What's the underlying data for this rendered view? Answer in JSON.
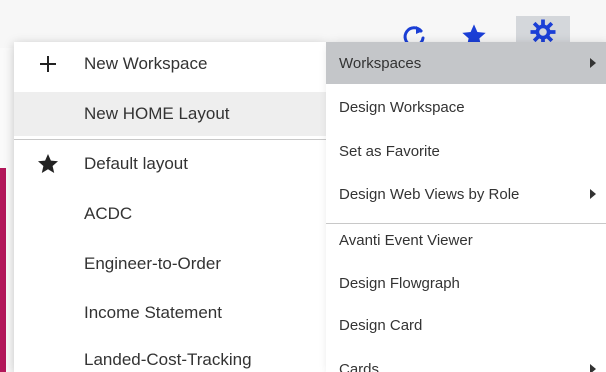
{
  "toolbar": {
    "icons": [
      "refresh-icon",
      "star-icon",
      "gear-icon"
    ],
    "accent_color": "#1b3fd6"
  },
  "workspace_menu": {
    "items": [
      {
        "icon": "plus-icon",
        "label": "New Workspace"
      },
      {
        "icon": "",
        "label": "New HOME Layout"
      },
      {
        "icon": "star-icon",
        "label": "Default layout"
      },
      {
        "icon": "",
        "label": "ACDC"
      },
      {
        "icon": "",
        "label": "Engineer-to-Order"
      },
      {
        "icon": "",
        "label": "Income Statement"
      },
      {
        "icon": "",
        "label": "Landed-Cost-Tracking"
      }
    ],
    "highlighted": "New HOME Layout"
  },
  "settings_menu": {
    "items": [
      {
        "label": "Workspaces",
        "submenu": true
      },
      {
        "label": "Design Workspace",
        "submenu": false
      },
      {
        "label": "Set as Favorite",
        "submenu": false
      },
      {
        "label": "Design Web Views by Role",
        "submenu": true
      },
      {
        "label": "Avanti Event Viewer",
        "submenu": false
      },
      {
        "label": "Design Flowgraph",
        "submenu": false
      },
      {
        "label": "Design Card",
        "submenu": false
      },
      {
        "label": "Cards",
        "submenu": true
      }
    ],
    "highlighted": "Workspaces",
    "highlight_color": "#c4c6c9"
  },
  "colors": {
    "page_accent": "#b3175a",
    "menu_text": "#333333",
    "hover_bg": "#eeeeee"
  }
}
